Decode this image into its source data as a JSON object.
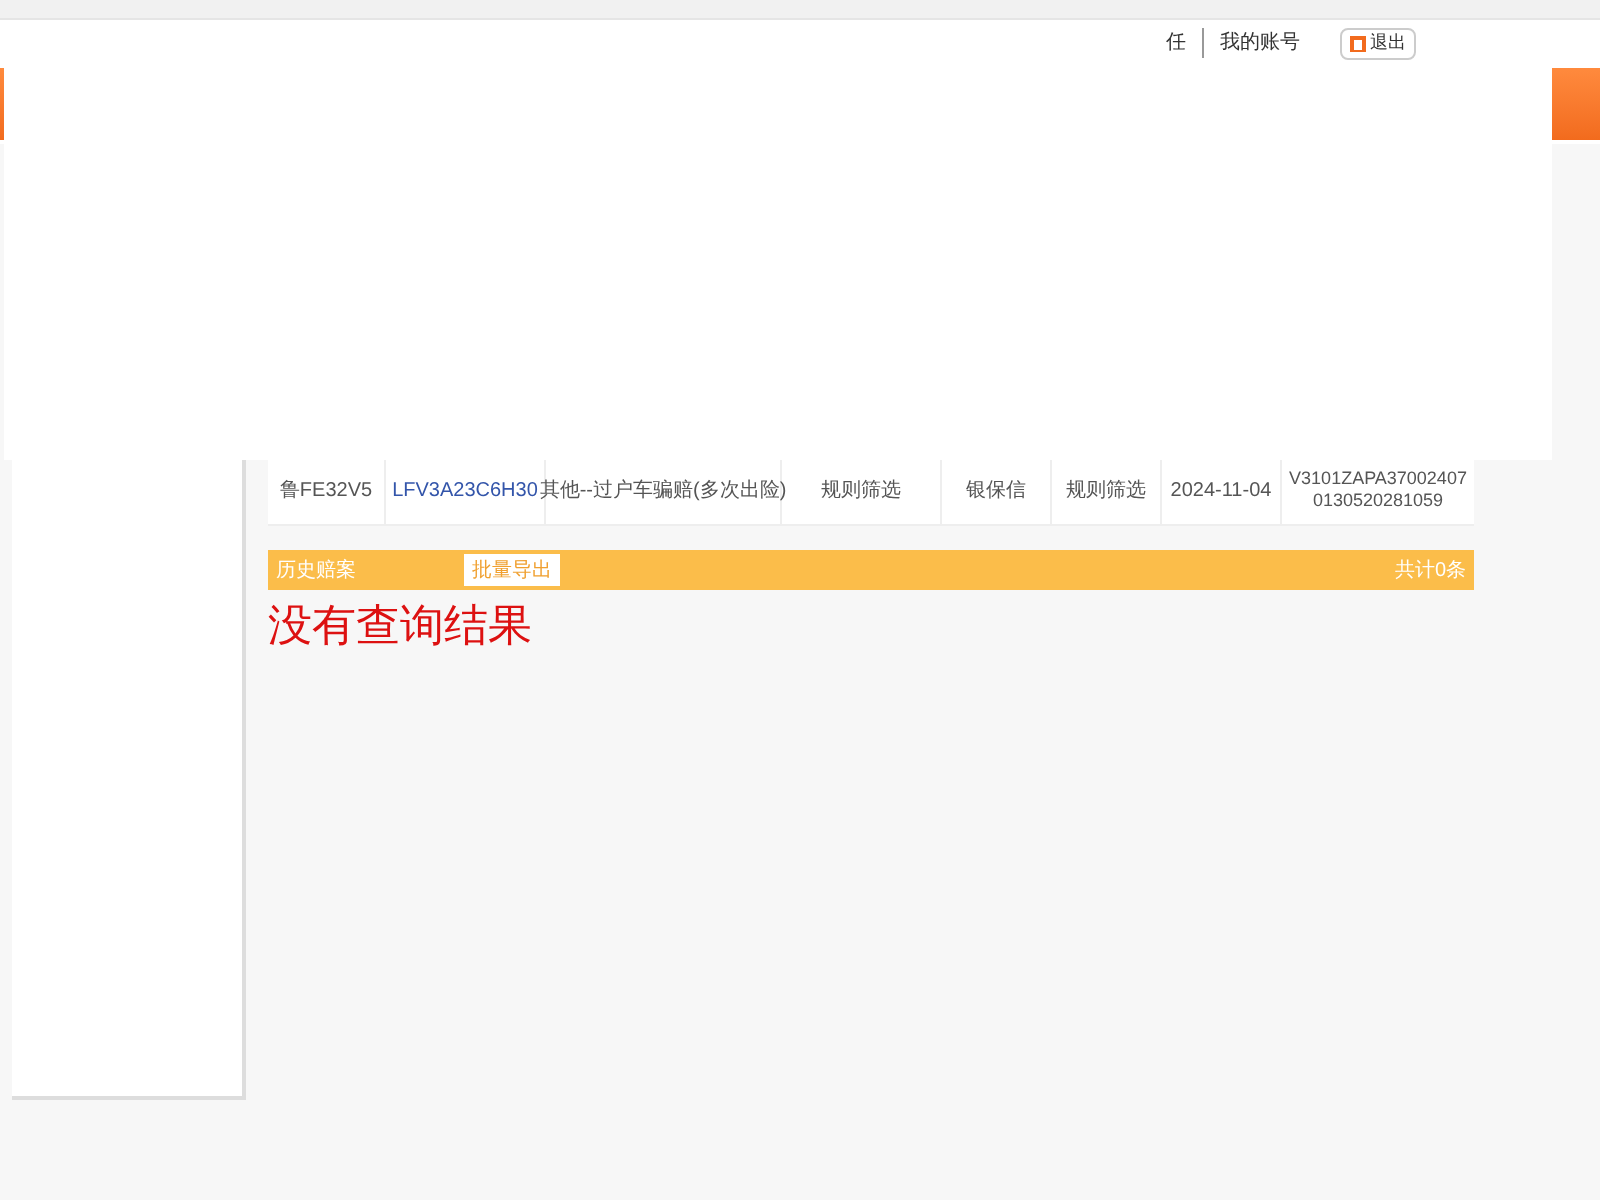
{
  "header": {
    "links": [
      {
        "label": "任"
      },
      {
        "label": "我的账号"
      }
    ],
    "logout": "退出"
  },
  "table": {
    "row": {
      "plate": "鲁FE32V5",
      "vin": "LFV3A23C6H30",
      "reason": "其他--过户车骗赔(多次出险)",
      "source": "规则筛选",
      "company": "银保信",
      "method": "规则筛选",
      "date": "2024-11-04",
      "policy": "V3101ZAPA370024070130520281059"
    }
  },
  "history": {
    "title": "历史赔案",
    "export_button": "批量导出",
    "count": "共计0条"
  },
  "empty_message": "没有查询结果"
}
